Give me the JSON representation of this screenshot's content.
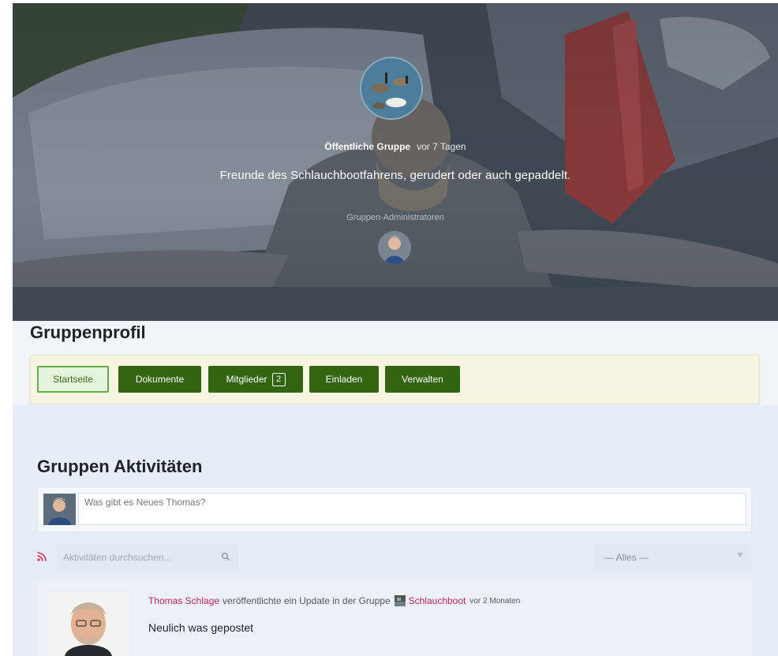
{
  "cover": {
    "group_type": "Öffentliche Gruppe",
    "created": "vor 7 Tagen",
    "description": "Freunde des Schlauchbootfahrens, gerudert oder auch gepaddelt.",
    "admins_label": "Gruppen-Administratoren"
  },
  "profile": {
    "title": "Gruppenprofil"
  },
  "nav": {
    "items": [
      {
        "label": "Startseite",
        "active": true
      },
      {
        "label": "Dokumente",
        "active": false
      },
      {
        "label": "Mitglieder",
        "count": "2",
        "active": false
      },
      {
        "label": "Einladen",
        "active": false
      },
      {
        "label": "Verwalten",
        "active": false
      }
    ]
  },
  "activity": {
    "title": "Gruppen Aktivitäten",
    "composer_placeholder": "Was gibt es Neues Thomas?",
    "search_placeholder": "Aktivitäten durchsuchen...",
    "filter_value": "— Alles —",
    "entries": [
      {
        "user": "Thomas Schlage",
        "action": "veröffentlichte ein Update in der Gruppe",
        "group": "Schlauchboot",
        "time": "vor 2 Monaten",
        "content": "Neulich was gepostet"
      }
    ]
  },
  "colors": {
    "nav_button": "#336410",
    "nav_active_border": "#63ad46",
    "link": "#b72763",
    "rss": "#cc2a53"
  }
}
